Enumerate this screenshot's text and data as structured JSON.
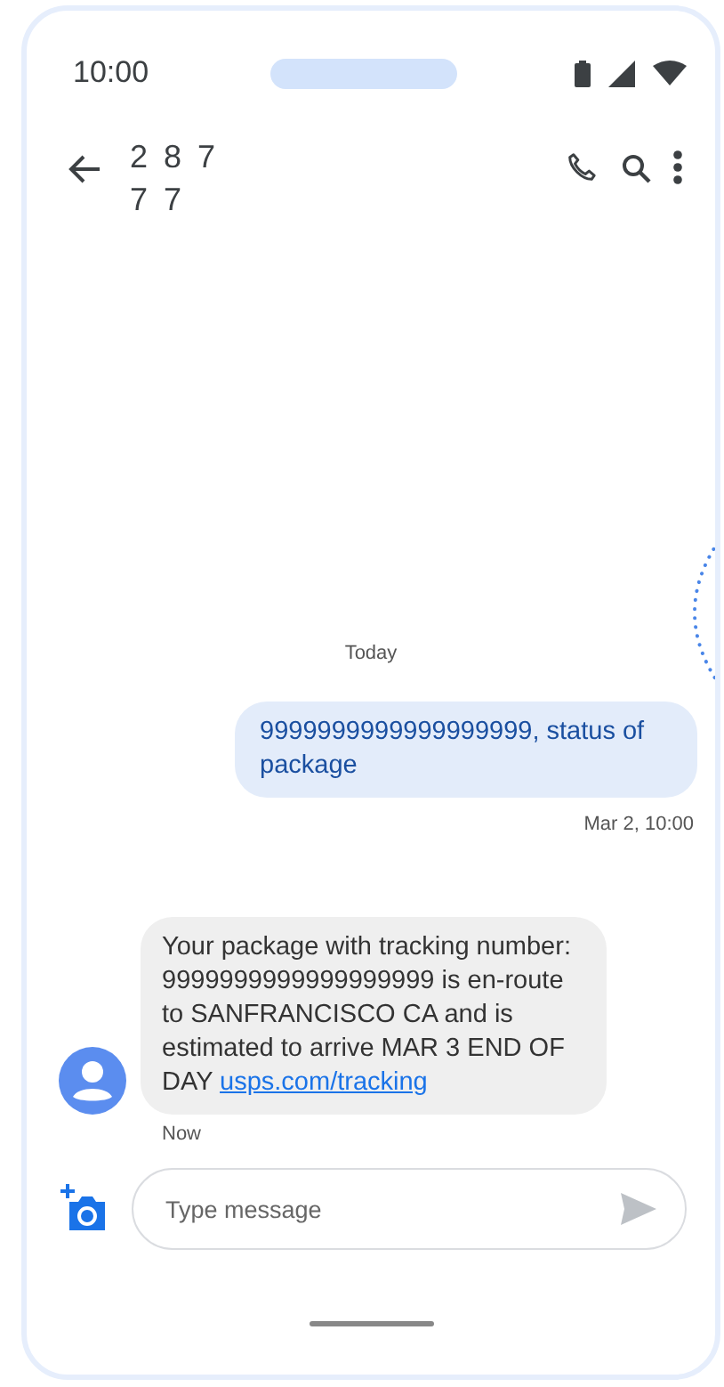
{
  "status_bar": {
    "time": "10:00"
  },
  "header": {
    "contact": "2 8 7 7 7"
  },
  "date_divider": "Today",
  "messages": [
    {
      "kind": "sent",
      "text": "9999999999999999999, status of package",
      "time": "Mar 2, 10:00"
    },
    {
      "kind": "received",
      "text": "Your package with tracking number: 9999999999999999999 is en-route to SANFRANCISCO CA and is estimated to arrive MAR 3 END OF DAY",
      "link": "usps.com/tracking",
      "time": "Now"
    }
  ],
  "composer": {
    "placeholder": "Type message"
  }
}
